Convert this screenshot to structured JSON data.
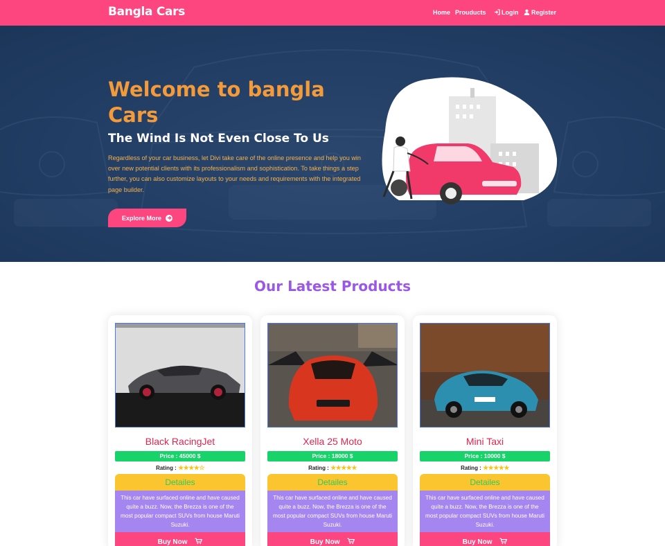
{
  "navbar": {
    "brand": "Bangla Cars",
    "home": "Home",
    "products": "Prouducts",
    "login": "Login",
    "register": "Register"
  },
  "hero": {
    "title": "Welcome to bangla Cars",
    "subtitle": "The Wind Is Not Even Close To Us",
    "text": "Regardless of your car business, let Divi take care of the online presence and help you win over new potential clients with its professionalism and sophistication. To take things a step further, you can also customize layouts to your needs and requirements with the integrated page builder.",
    "button": "Explore More"
  },
  "products": {
    "title": "Our Latest Products",
    "details_label": "Detailes",
    "buy_label": "Buy Now",
    "items": [
      {
        "name": "Black RacingJet",
        "price": "Price : 45000 $",
        "rating_label": "Rating :",
        "stars": "★★★★☆",
        "rating": 4,
        "description": "This car have surfaced online and have caused quite a buzz. Now, the Brezza is one of the most popular compact SUVs from house Maruti Suzuki."
      },
      {
        "name": "Xella 25 Moto",
        "price": "Price : 18000 $",
        "rating_label": "Rating :",
        "stars": "★★★★★",
        "rating": 4.5,
        "description": "This car have surfaced online and have caused quite a buzz. Now, the Brezza is one of the most popular compact SUVs from house Maruti Suzuki."
      },
      {
        "name": "Mini Taxi",
        "price": "Price : 10000 $",
        "rating_label": "Rating :",
        "stars": "★★★★★",
        "rating": 5,
        "description": "This car have surfaced online and have caused quite a buzz. Now, the Brezza is one of the most popular compact SUVs from house Maruti Suzuki."
      }
    ]
  },
  "colors": {
    "primary": "#fd4580",
    "hero_title": "#f39a3a",
    "section_title": "#9b57e6",
    "price_bg": "#18d36a",
    "details_bg": "#fbc52f",
    "desc_bg": "#a585f0"
  }
}
